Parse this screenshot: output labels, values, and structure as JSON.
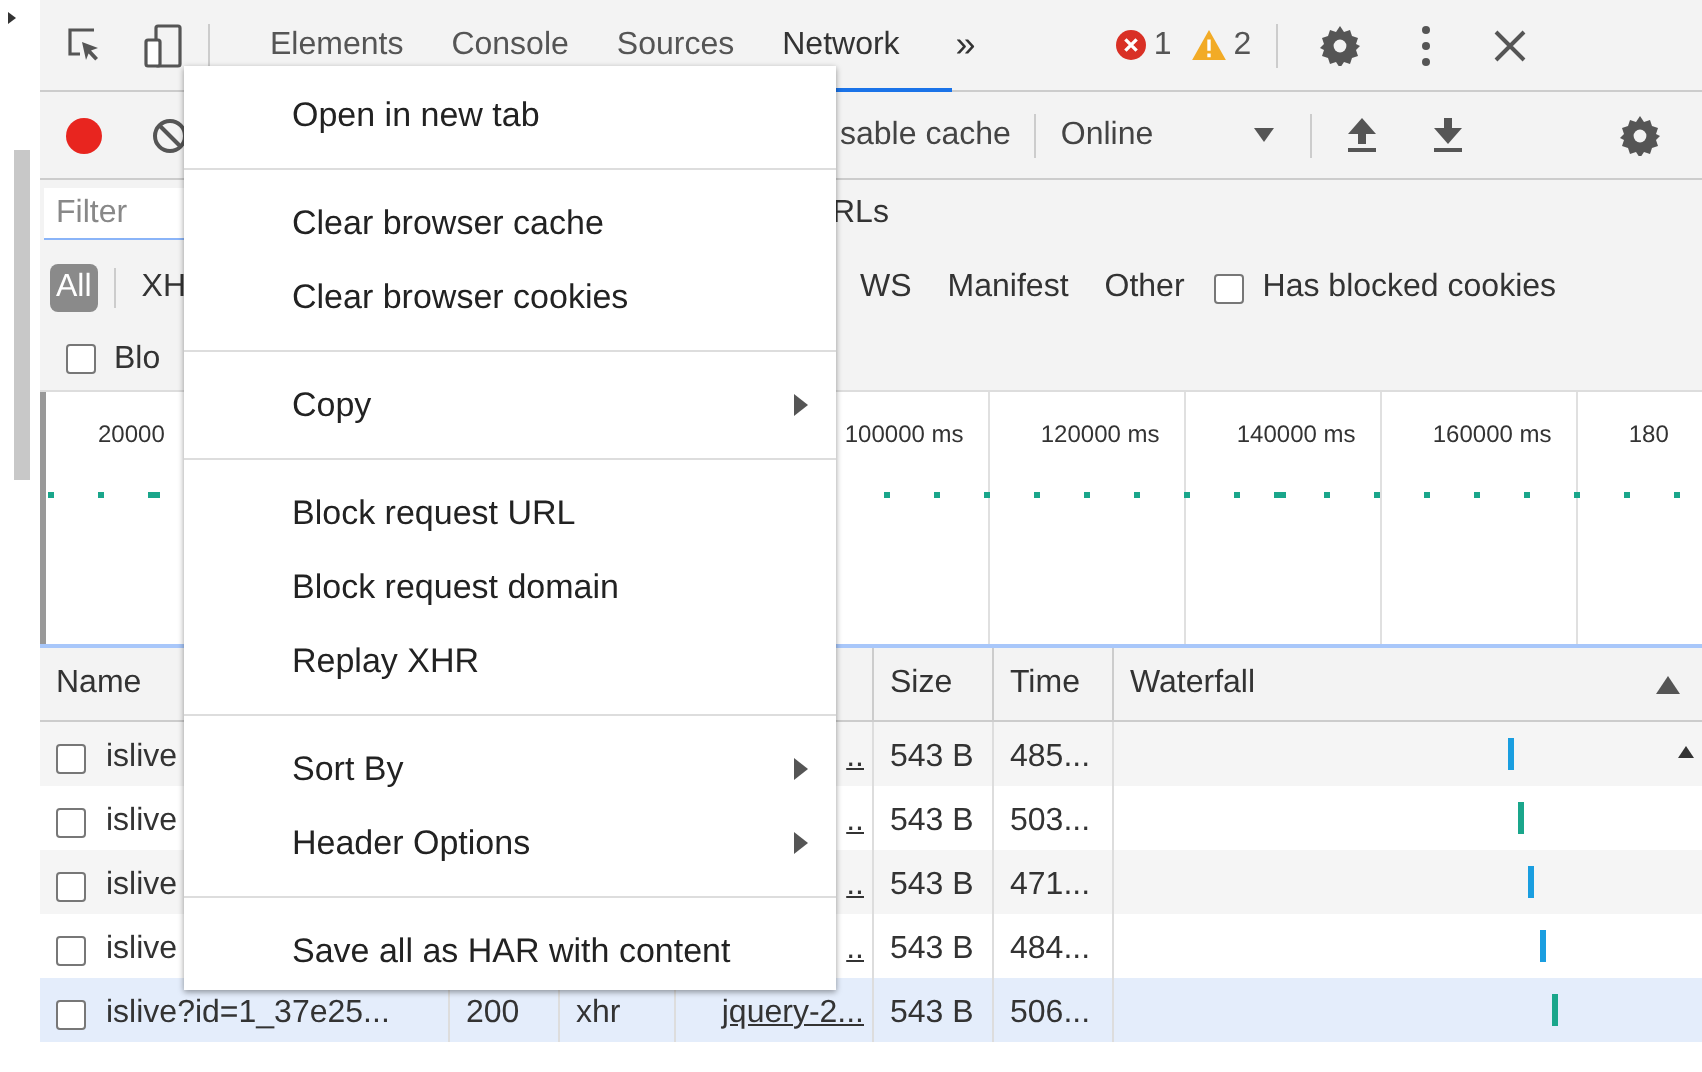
{
  "tabs": [
    {
      "label": "Elements",
      "selected": false
    },
    {
      "label": "Console",
      "selected": false
    },
    {
      "label": "Sources",
      "selected": false
    },
    {
      "label": "Network",
      "selected": true
    }
  ],
  "more_tabs": "»",
  "error_count": "1",
  "warning_count": "2",
  "toolbar": {
    "recording": true,
    "disable_cache": "sable cache",
    "throttling": "Online"
  },
  "filter": {
    "placeholder": "Filter",
    "urls": "RLs"
  },
  "type_filters_left": [
    {
      "label": "All",
      "selected": true
    },
    {
      "label": "XH",
      "selected": false
    }
  ],
  "type_filters_right": [
    {
      "label": "WS",
      "selected": false
    },
    {
      "label": "Manifest",
      "selected": false
    },
    {
      "label": "Other",
      "selected": false
    }
  ],
  "has_blocked_cookies": {
    "label": "Has blocked cookies",
    "checked": false
  },
  "blocked_requests": {
    "label": "Blo",
    "checked": false
  },
  "overview": {
    "first_tick": "20000",
    "ticks": [
      "100000 ms",
      "120000 ms",
      "140000 ms",
      "160000 ms",
      "180"
    ]
  },
  "table": {
    "columns": [
      "Name",
      "Size",
      "Time",
      "Waterfall"
    ],
    "rows": [
      {
        "name": "islive",
        "initiator": "..",
        "size": "543 B",
        "time": "485...",
        "selected": false,
        "checked": false
      },
      {
        "name": "islive",
        "initiator": "..",
        "size": "543 B",
        "time": "503...",
        "selected": false,
        "checked": false
      },
      {
        "name": "islive",
        "initiator": "..",
        "size": "543 B",
        "time": "471...",
        "selected": false,
        "checked": false
      },
      {
        "name": "islive",
        "initiator": "..",
        "size": "543 B",
        "time": "484...",
        "selected": false,
        "checked": false
      },
      {
        "name": "islive?id=1_37e25...",
        "status": "200",
        "type": "xhr",
        "initiator": "jquery-2...",
        "size": "543 B",
        "time": "506...",
        "selected": true,
        "checked": false
      }
    ]
  },
  "context_menu": {
    "groups": [
      [
        {
          "label": "Open in new tab",
          "submenu": false
        }
      ],
      [
        {
          "label": "Clear browser cache",
          "submenu": false
        },
        {
          "label": "Clear browser cookies",
          "submenu": false
        }
      ],
      [
        {
          "label": "Copy",
          "submenu": true
        }
      ],
      [
        {
          "label": "Block request URL",
          "submenu": false
        },
        {
          "label": "Block request domain",
          "submenu": false
        },
        {
          "label": "Replay XHR",
          "submenu": false
        }
      ],
      [
        {
          "label": "Sort By",
          "submenu": true
        },
        {
          "label": "Header Options",
          "submenu": true
        }
      ],
      [
        {
          "label": "Save all as HAR with content",
          "submenu": false
        }
      ]
    ]
  }
}
